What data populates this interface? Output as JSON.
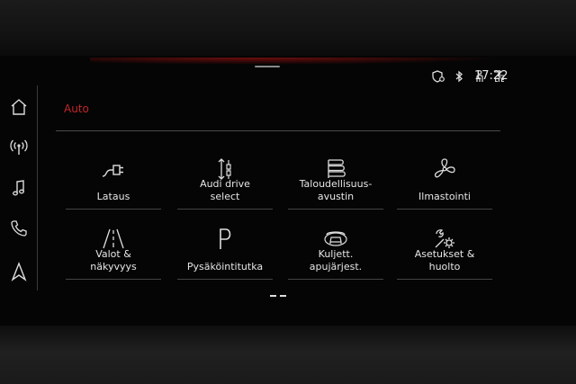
{
  "status": {
    "icons": [
      "location-shield-icon",
      "bluetooth-icon",
      "seat-user-icon",
      "lte-signal-icon"
    ],
    "network": "LTE",
    "time": "17:22"
  },
  "sidebar": {
    "items": [
      {
        "icon": "home-icon"
      },
      {
        "icon": "radio-icon"
      },
      {
        "icon": "music-icon"
      },
      {
        "icon": "phone-icon"
      },
      {
        "icon": "navigation-icon"
      }
    ]
  },
  "page": {
    "title": "Auto"
  },
  "tiles": [
    {
      "label": "Lataus",
      "icon": "charging-plug-icon"
    },
    {
      "label": "Audi drive\nselect",
      "icon": "drive-select-icon"
    },
    {
      "label": "Taloudellisuus-\navustin",
      "icon": "efficiency-icon"
    },
    {
      "label": "Ilmastointi",
      "icon": "fan-icon"
    },
    {
      "label": "Valot &\nnäkyvyys",
      "icon": "lights-road-icon"
    },
    {
      "label": "Pysäköintitutka",
      "icon": "parking-icon",
      "glyph": "P"
    },
    {
      "label": "Kuljett.\napujärjest.",
      "icon": "driver-assist-icon"
    },
    {
      "label": "Asetukset &\nhuolto",
      "icon": "settings-service-icon"
    }
  ],
  "colors": {
    "accent": "#c0262a",
    "text": "#e6e6e6",
    "background": "#050505"
  }
}
